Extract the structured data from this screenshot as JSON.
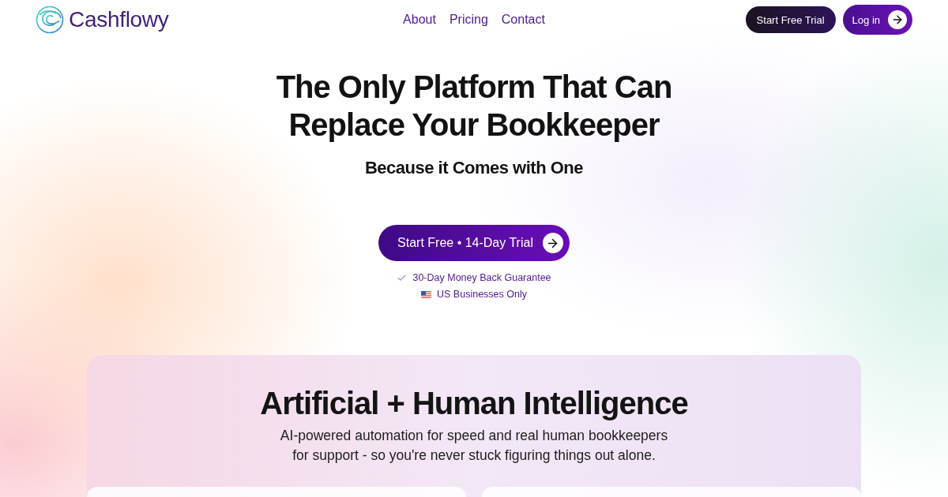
{
  "header": {
    "logo": {
      "text": "Cashflowy"
    },
    "nav": [
      {
        "label": "About"
      },
      {
        "label": "Pricing"
      },
      {
        "label": "Contact"
      }
    ],
    "buttons": [
      {
        "label": "Start Free Trial",
        "kind": "dark"
      },
      {
        "label": "Log in",
        "kind": "primary"
      }
    ]
  },
  "hero": {
    "title_lines": [
      "The Only Platform That Can",
      "Replace Your Bookkeeper"
    ],
    "subtitle": "Because it Comes with One",
    "cta": "Start Free • 14-Day Trial",
    "badges": [
      {
        "kind": "check",
        "text": "30-Day Money Back Guarantee"
      },
      {
        "kind": "flag",
        "text": "US Businesses Only"
      }
    ]
  },
  "section": {
    "title": "Artificial + Human Intelligence",
    "description_lines": [
      "AI-powered automation for speed and real human bookkeepers",
      "for support - so you're never stuck figuring things out alone."
    ]
  }
}
